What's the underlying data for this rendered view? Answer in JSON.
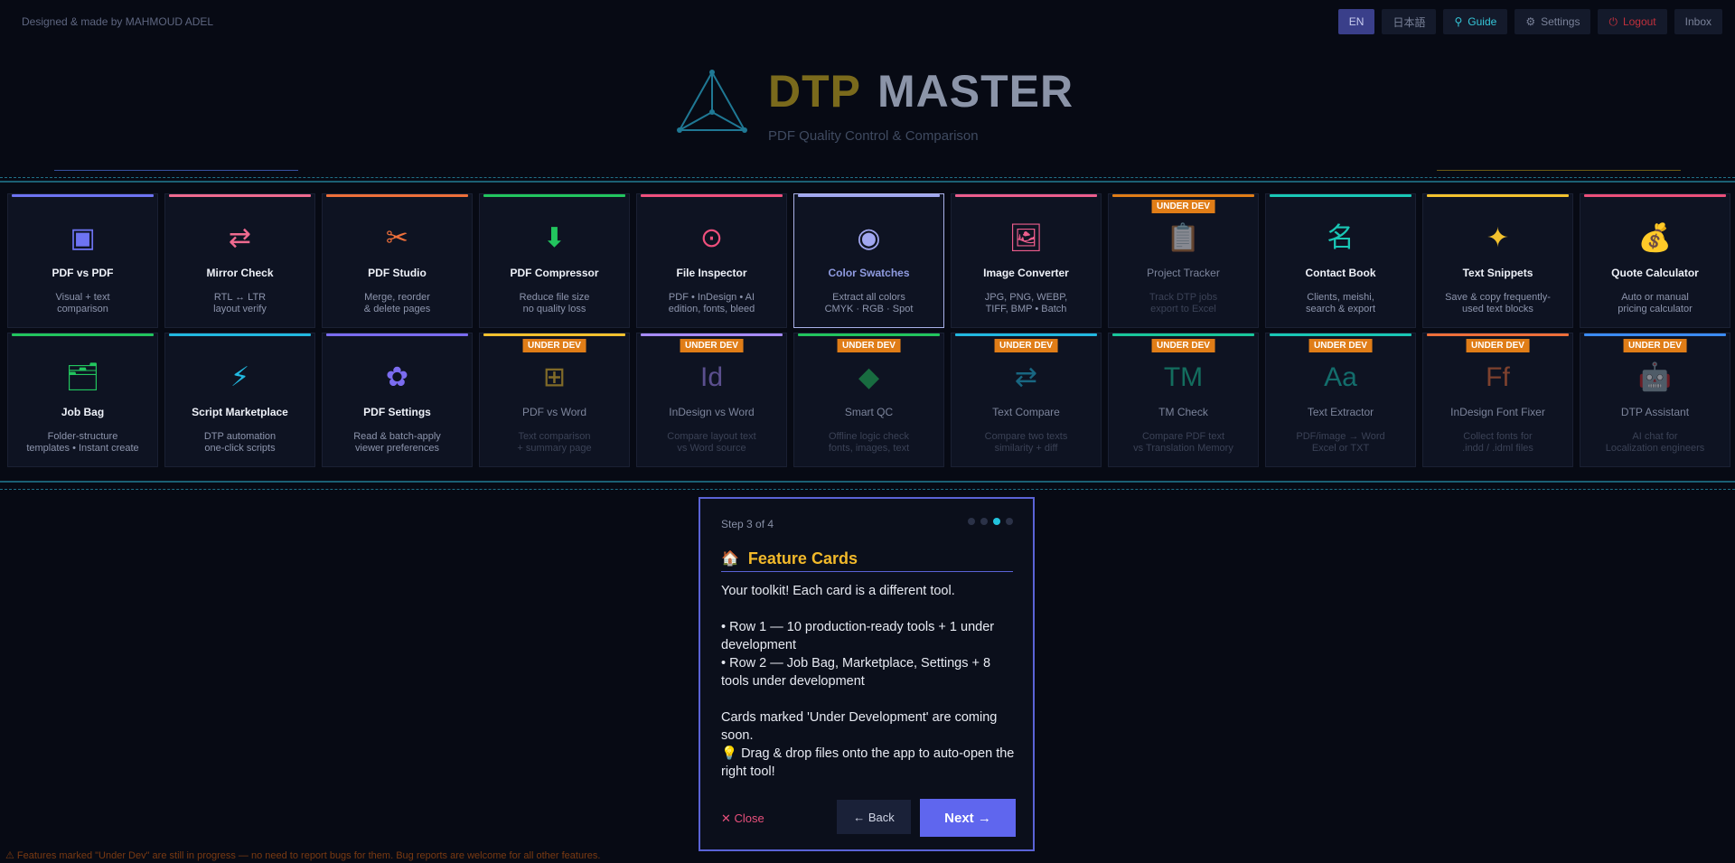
{
  "credit": "Designed & made by  MAHMOUD ADEL",
  "topbar": {
    "lang_en": "EN",
    "lang_ja": "日本語",
    "guide": "Guide",
    "settings": "Settings",
    "logout": "Logout",
    "inbox": "Inbox"
  },
  "header": {
    "brand_1": "DTP",
    "brand_2": "MASTER",
    "subtitle": "PDF Quality Control & Comparison"
  },
  "cards": [
    {
      "title": "PDF  vs  PDF",
      "desc": "Visual + text\ncomparison",
      "icon": "▣",
      "color": "#6d73f2",
      "badge": ""
    },
    {
      "title": "Mirror Check",
      "desc": "RTL ↔ LTR\nlayout verify",
      "icon": "⇄",
      "color": "#ef6a8f",
      "badge": ""
    },
    {
      "title": "PDF Studio",
      "desc": "Merge, reorder\n& delete pages",
      "icon": "✂",
      "color": "#ee6f3a",
      "badge": ""
    },
    {
      "title": "PDF Compressor",
      "desc": "Reduce file size\nno quality loss",
      "icon": "⬇",
      "color": "#22c55e",
      "badge": ""
    },
    {
      "title": "File Inspector",
      "desc": "PDF • InDesign • AI\nedition, fonts, bleed",
      "icon": "⊙",
      "color": "#ef4f7c",
      "badge": ""
    },
    {
      "title": "Color Swatches",
      "desc": "Extract all colors\nCMYK · RGB · Spot",
      "icon": "◉",
      "color": "#a1a7f0",
      "badge": ""
    },
    {
      "title": "Image Converter",
      "desc": "JPG, PNG, WEBP,\nTIFF, BMP • Batch",
      "icon": "🖼",
      "color": "#ec5d8c",
      "badge": ""
    },
    {
      "title": "Project Tracker",
      "desc": "Track DTP jobs\nexport to Excel",
      "icon": "📋",
      "color": "#e07d17",
      "badge": "UNDER DEV"
    },
    {
      "title": "Contact Book",
      "desc": "Clients, meishi,\nsearch & export",
      "icon": "名",
      "color": "#19c7b5",
      "badge": ""
    },
    {
      "title": "Text Snippets",
      "desc": "Save & copy frequently-\nused text blocks",
      "icon": "✦",
      "color": "#f2c12e",
      "badge": ""
    },
    {
      "title": "Quote Calculator",
      "desc": "Auto or manual\npricing calculator",
      "icon": "💰",
      "color": "#ec4f7a",
      "badge": ""
    },
    {
      "title": "Job Bag",
      "desc": "Folder-structure\ntemplates • Instant create",
      "icon": "🗂",
      "color": "#22c55e",
      "badge": ""
    },
    {
      "title": "Script Marketplace",
      "desc": "DTP automation\none-click scripts",
      "icon": "⚡",
      "color": "#22b8e0",
      "badge": ""
    },
    {
      "title": "PDF Settings",
      "desc": "Read & batch-apply\nviewer preferences",
      "icon": "✿",
      "color": "#7b6cf0",
      "badge": ""
    },
    {
      "title": "PDF  vs  Word",
      "desc": "Text comparison\n+ summary page",
      "icon": "⊞",
      "color": "#f2c12e",
      "badge": "UNDER DEV"
    },
    {
      "title": "InDesign vs Word",
      "desc": "Compare layout text\nvs Word source",
      "icon": "Id",
      "color": "#a78bfa",
      "badge": "UNDER DEV"
    },
    {
      "title": "Smart QC",
      "desc": "Offline logic check\nfonts, images, text",
      "icon": "◆",
      "color": "#22c55e",
      "badge": "UNDER DEV"
    },
    {
      "title": "Text Compare",
      "desc": "Compare two texts\nsimilarity + diff",
      "icon": "⇄",
      "color": "#22b8e0",
      "badge": "UNDER DEV"
    },
    {
      "title": "TM Check",
      "desc": "Compare PDF text\nvs Translation Memory",
      "icon": "TM",
      "color": "#19c79b",
      "badge": "UNDER DEV"
    },
    {
      "title": "Text Extractor",
      "desc": "PDF/image → Word\nExcel or TXT",
      "icon": "Aa",
      "color": "#19c7b5",
      "badge": "UNDER DEV"
    },
    {
      "title": "InDesign Font Fixer",
      "desc": "Collect fonts for\n.indd / .idml files",
      "icon": "Ff",
      "color": "#ee6f3a",
      "badge": "UNDER DEV"
    },
    {
      "title": "DTP Assistant",
      "desc": "AI chat for\nLocalization engineers",
      "icon": "🤖",
      "color": "#3b8bf2",
      "badge": "UNDER DEV"
    }
  ],
  "tour": {
    "step": "Step 3 of 4",
    "title": "Feature Cards",
    "intro": "Your toolkit! Each card is a different tool.",
    "row1": "• Row 1 — 10 production-ready tools + 1 under development",
    "row2": "• Row 2 — Job Bag, Marketplace, Settings + 8 tools under development",
    "under_dev": "Cards marked 'Under Development' are coming soon.",
    "tip": "💡 Drag & drop files onto the app to auto-open the right tool!",
    "close": "✕  Close",
    "back": "←  Back",
    "next": "Next  →"
  },
  "footnote": "⚠ Features marked \"Under Dev\" are still in progress — no need to report bugs for them. Bug reports are welcome for all other features."
}
